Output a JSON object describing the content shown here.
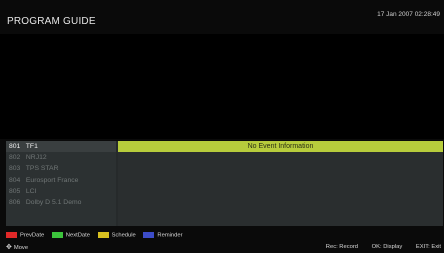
{
  "header": {
    "title": "PROGRAM GUIDE",
    "datetime": "17 Jan 2007 02:28:49"
  },
  "channels": [
    {
      "number": "801",
      "name": "TF1",
      "selected": true
    },
    {
      "number": "802",
      "name": "NRJ12",
      "selected": false
    },
    {
      "number": "803",
      "name": "TPS STAR",
      "selected": false
    },
    {
      "number": "804",
      "name": "Eurosport France",
      "selected": false
    },
    {
      "number": "805",
      "name": "LCI",
      "selected": false
    },
    {
      "number": "806",
      "name": "Dolby D 5.1 Demo",
      "selected": false
    }
  ],
  "events": {
    "current": "No Event Information"
  },
  "legend": [
    {
      "label": "PrevDate",
      "color": "#e02828"
    },
    {
      "label": "NextDate",
      "color": "#3cc43c"
    },
    {
      "label": "Schedule",
      "color": "#d8c020"
    },
    {
      "label": "Reminder",
      "color": "#3c4cc8"
    }
  ],
  "move": {
    "label": "Move",
    "icon": "dpad-icon"
  },
  "hints": [
    {
      "label": "Rec: Record"
    },
    {
      "label": "OK: Display"
    },
    {
      "label": "EXIT: Exit"
    }
  ],
  "colors": {
    "background": "#0a0a0a",
    "guide_panel": "#262a2b",
    "event_highlight": "#b7cc3c"
  }
}
